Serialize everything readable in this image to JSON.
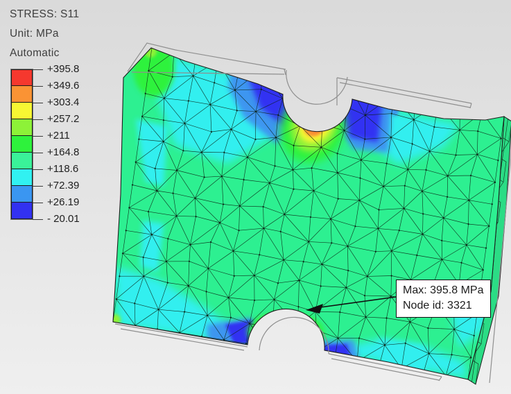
{
  "viewport": {
    "background_top": "#dadada",
    "background_bottom": "#efefef",
    "body_color": "#2df091"
  },
  "header": {
    "field": "STRESS: S11",
    "unit": "Unit: MPa",
    "scale_mode": "Automatic"
  },
  "legend": {
    "tick_labels": [
      "+395.8",
      "+349.6",
      "+303.4",
      "+257.2",
      "+211",
      "+164.8",
      "+118.6",
      "+72.39",
      "+26.19",
      "- 20.01"
    ],
    "band_colors": [
      "#f5382e",
      "#fa9334",
      "#f7f733",
      "#8df238",
      "#2ef23c",
      "#3af299",
      "#31f1f1",
      "#3a96f1",
      "#3231f1"
    ]
  },
  "annotation": {
    "max_label": "Max: 395.8 MPa",
    "node_label": "Node id: 3321"
  },
  "chart_data": {
    "type": "heatmap",
    "title": "STRESS: S11",
    "unit": "MPa",
    "scale_mode": "Automatic",
    "legend_position": "left",
    "band_boundaries_mpa": [
      395.8,
      349.6,
      303.4,
      257.2,
      211,
      164.8,
      118.6,
      72.39,
      26.19,
      -20.01
    ],
    "band_colors_top_to_bottom": [
      "#f5382e",
      "#fa9334",
      "#f7f733",
      "#8df238",
      "#2ef23c",
      "#3af299",
      "#31f1f1",
      "#3a96f1",
      "#3231f1"
    ],
    "range_max_mpa": 395.8,
    "range_min_mpa": -20.01,
    "annotated_max": {
      "value_mpa": 395.8,
      "node_id": 3321
    }
  }
}
